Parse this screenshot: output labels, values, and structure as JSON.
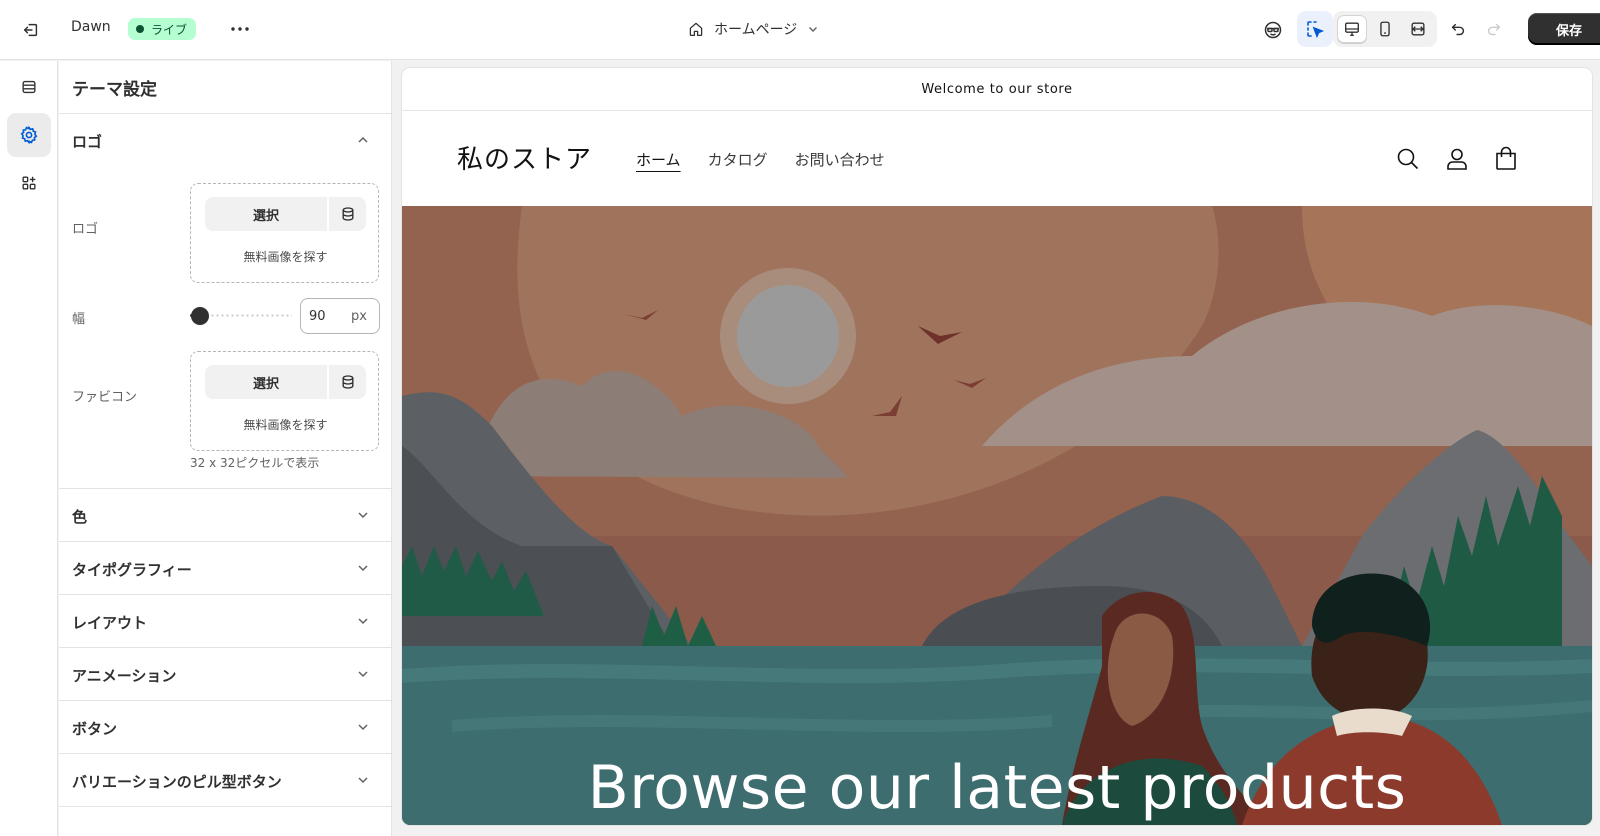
{
  "topbar": {
    "theme_name": "Dawn",
    "live_label": "ライブ",
    "page_selector": "ホームページ",
    "save_label": "保存"
  },
  "panel": {
    "title": "テーマ設定",
    "logo_section": {
      "title": "ロゴ",
      "logo_label": "ロゴ",
      "select_label": "選択",
      "free_images_label": "無料画像を探す",
      "width_label": "幅",
      "width_value": "90",
      "width_unit": "px",
      "width_slider_fraction": 0.1,
      "favicon_label": "ファビコン",
      "favicon_select_label": "選択",
      "favicon_free_images_label": "無料画像を探す",
      "favicon_help": "32 x 32ピクセルで表示"
    },
    "sections": [
      "色",
      "タイポグラフィー",
      "レイアウト",
      "アニメーション",
      "ボタン",
      "バリエーションのピル型ボタン"
    ]
  },
  "preview": {
    "announcement": "Welcome to our store",
    "store_name": "私のストア",
    "nav": [
      "ホーム",
      "カタログ",
      "お問い合わせ"
    ],
    "hero_title": "Browse our latest products"
  },
  "colors": {
    "live_badge_bg": "#b4fed2",
    "save_bg": "#303030",
    "accent_blue": "#005bd3"
  }
}
